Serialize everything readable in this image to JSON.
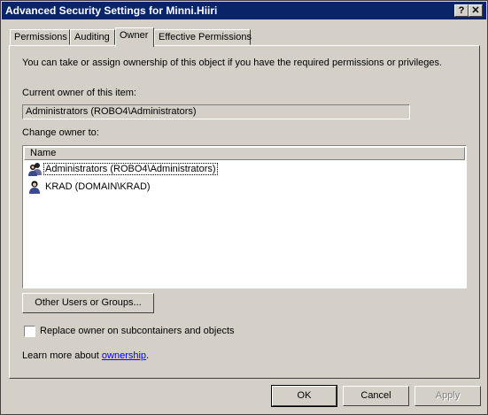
{
  "window": {
    "title": "Advanced Security Settings for Minni.Hiiri",
    "help_glyph": "?",
    "close_glyph": "✕"
  },
  "tabs": [
    {
      "label": "Permissions",
      "active": false
    },
    {
      "label": "Auditing",
      "active": false
    },
    {
      "label": "Owner",
      "active": true
    },
    {
      "label": "Effective Permissions",
      "active": false
    }
  ],
  "owner": {
    "intro": "You can take or assign ownership of this object if you have the required permissions or privileges.",
    "current_label": "Current owner of this item:",
    "current_value": "Administrators (ROBO4\\Administrators)",
    "change_label": "Change owner to:",
    "column_name": "Name",
    "list": [
      {
        "name": "Administrators (ROBO4\\Administrators)",
        "icon": "user-group-icon",
        "focused": true
      },
      {
        "name": "KRAD (DOMAIN\\KRAD)",
        "icon": "user-icon",
        "focused": false
      }
    ],
    "other_button": "Other Users or Groups...",
    "replace_checkbox_label": "Replace owner on subcontainers and objects",
    "replace_checked": false,
    "learn_prefix": "Learn more about ",
    "learn_link": "ownership",
    "learn_suffix": "."
  },
  "buttons": {
    "ok": "OK",
    "cancel": "Cancel",
    "apply": "Apply"
  }
}
